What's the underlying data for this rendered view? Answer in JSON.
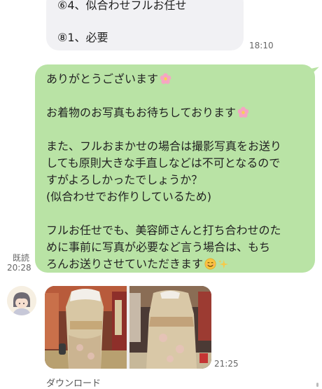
{
  "incoming": {
    "line1": "⑥4、似合わせフルお任せ",
    "line2": "⑧1、必要",
    "time": "18:10"
  },
  "outgoing": {
    "lines": [
      "ありがとうございます",
      "",
      "お着物のお写真もお待ちしております",
      "",
      "また、フルおまかせの場合は撮影写真をお送り",
      "しても原則大きな手直しなどは不可となるので",
      "すがよろしかったでしょうか？",
      "(似合わせでお作りしているため)",
      "",
      "フルお任せでも、美容師さんと打ち合わせのた",
      "めに事前に写真が必要など言う場合は、もち",
      "ろんお送りさせていただきます"
    ],
    "read_label": "既読",
    "read_time": "20:28"
  },
  "photos": {
    "time": "21:25",
    "download_label": "ダウンロード"
  },
  "icons": {
    "flower": "cherry-blossom-icon",
    "smile": "smiling-face-icon",
    "sparkle": "sparkles-icon",
    "avatar": "avatar-icon"
  },
  "colors": {
    "outgoing_bubble": "#b9e3a5",
    "incoming_bubble": "#f1f1f4"
  }
}
